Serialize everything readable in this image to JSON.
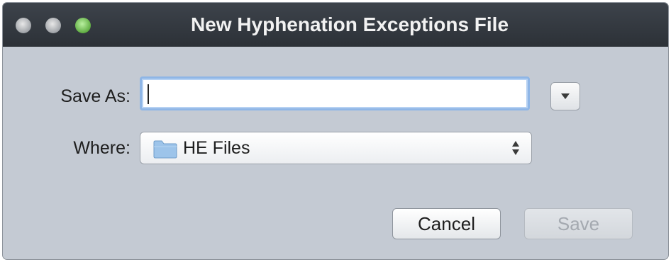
{
  "window": {
    "title": "New Hyphenation Exceptions File",
    "controls": [
      "close-button",
      "minimize-button",
      "zoom-button"
    ]
  },
  "form": {
    "save_as_label": "Save As:",
    "save_as_value": "",
    "where_label": "Where:",
    "where_value": "HE Files"
  },
  "buttons": {
    "cancel_label": "Cancel",
    "save_label": "Save",
    "save_enabled": false
  },
  "icons": {
    "expand": "triangle-down-icon",
    "folder": "folder-icon",
    "updown": "up-down-arrows-icon"
  },
  "colors": {
    "titlebar": "#2f343a",
    "dialog_bg": "#c4cad3",
    "focus_ring": "#8fb6e6",
    "zoom_button": "#5aa83c"
  }
}
